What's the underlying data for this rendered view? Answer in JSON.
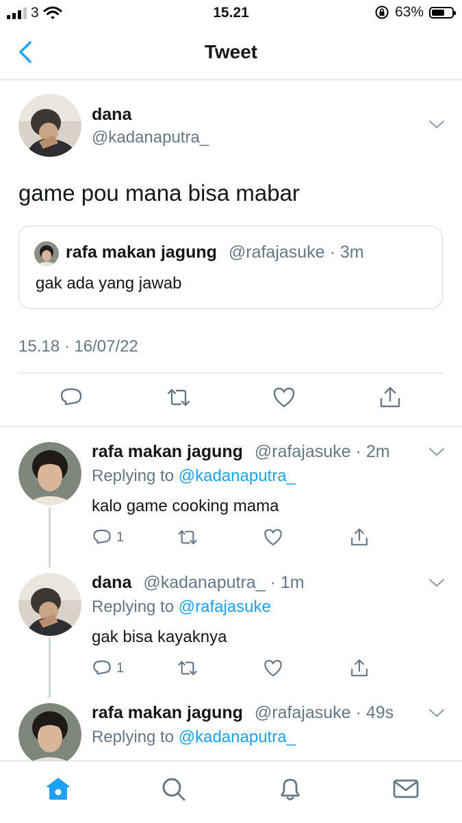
{
  "status_bar": {
    "carrier": "3",
    "time": "15.21",
    "battery": "63%",
    "battery_level": 0.63
  },
  "header": {
    "title": "Tweet"
  },
  "main_tweet": {
    "author_name": "dana",
    "author_handle": "@kadanaputra_",
    "text": "game pou mana bisa mabar",
    "quote": {
      "author_name": "rafa makan jagung",
      "author_handle": "@rafajasuke",
      "time": "· 3m",
      "text": "gak ada yang jawab"
    },
    "timestamp": "15.18 · 16/07/22"
  },
  "replies": [
    {
      "author_name": "rafa makan jagung",
      "author_handle": "@rafajasuke",
      "time": "· 2m",
      "replying_label": "Replying to",
      "replying_handle": "@kadanaputra_",
      "text": "kalo game cooking mama",
      "reply_count": "1"
    },
    {
      "author_name": "dana",
      "author_handle": "@kadanaputra_",
      "time": "· 1m",
      "replying_label": "Replying to",
      "replying_handle": "@rafajasuke",
      "text": "gak bisa kayaknya",
      "reply_count": "1"
    },
    {
      "author_name": "rafa makan jagung",
      "author_handle": "@rafajasuke",
      "time": "· 49s",
      "replying_label": "Replying to",
      "replying_handle": "@kadanaputra_"
    }
  ],
  "colors": {
    "accent": "#1da1f2",
    "muted": "#657786",
    "border": "#cfd9de"
  }
}
